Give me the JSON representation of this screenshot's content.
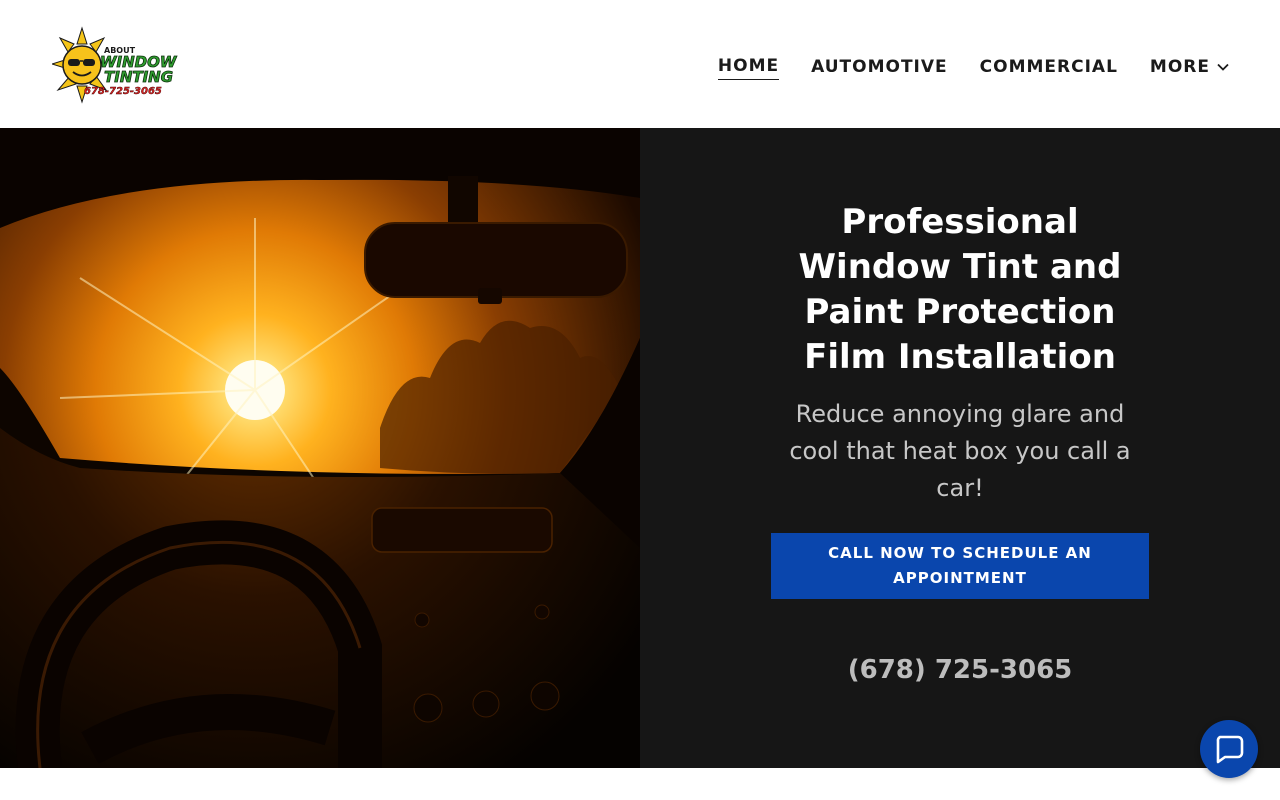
{
  "logo": {
    "line1": "ABOUT",
    "line2": "WINDOW",
    "line3": "TINTING",
    "phone": "678-725-3065"
  },
  "nav": {
    "items": [
      {
        "label": "HOME",
        "active": true
      },
      {
        "label": "AUTOMOTIVE",
        "active": false
      },
      {
        "label": "COMMERCIAL",
        "active": false
      },
      {
        "label": "MORE",
        "active": false
      }
    ],
    "more_icon": "chevron-down-icon"
  },
  "hero": {
    "headline": "Professional Window Tint and Paint Protection Film Installation",
    "subhead": "Reduce annoying glare and cool that heat box you call a car!",
    "cta_label": "CALL NOW TO SCHEDULE AN APPOINTMENT",
    "phone": "(678) 725-3065",
    "image_subject": "sunset through car windshield"
  },
  "chat": {
    "icon": "chat-bubble-icon"
  },
  "colors": {
    "accent": "#0a46ad",
    "panel_bg": "#161616",
    "headline": "#ffffff",
    "subhead": "#c7c7c7",
    "logo_green": "#2f9e2f",
    "logo_sun": "#f5c518",
    "logo_red": "#d62020"
  }
}
